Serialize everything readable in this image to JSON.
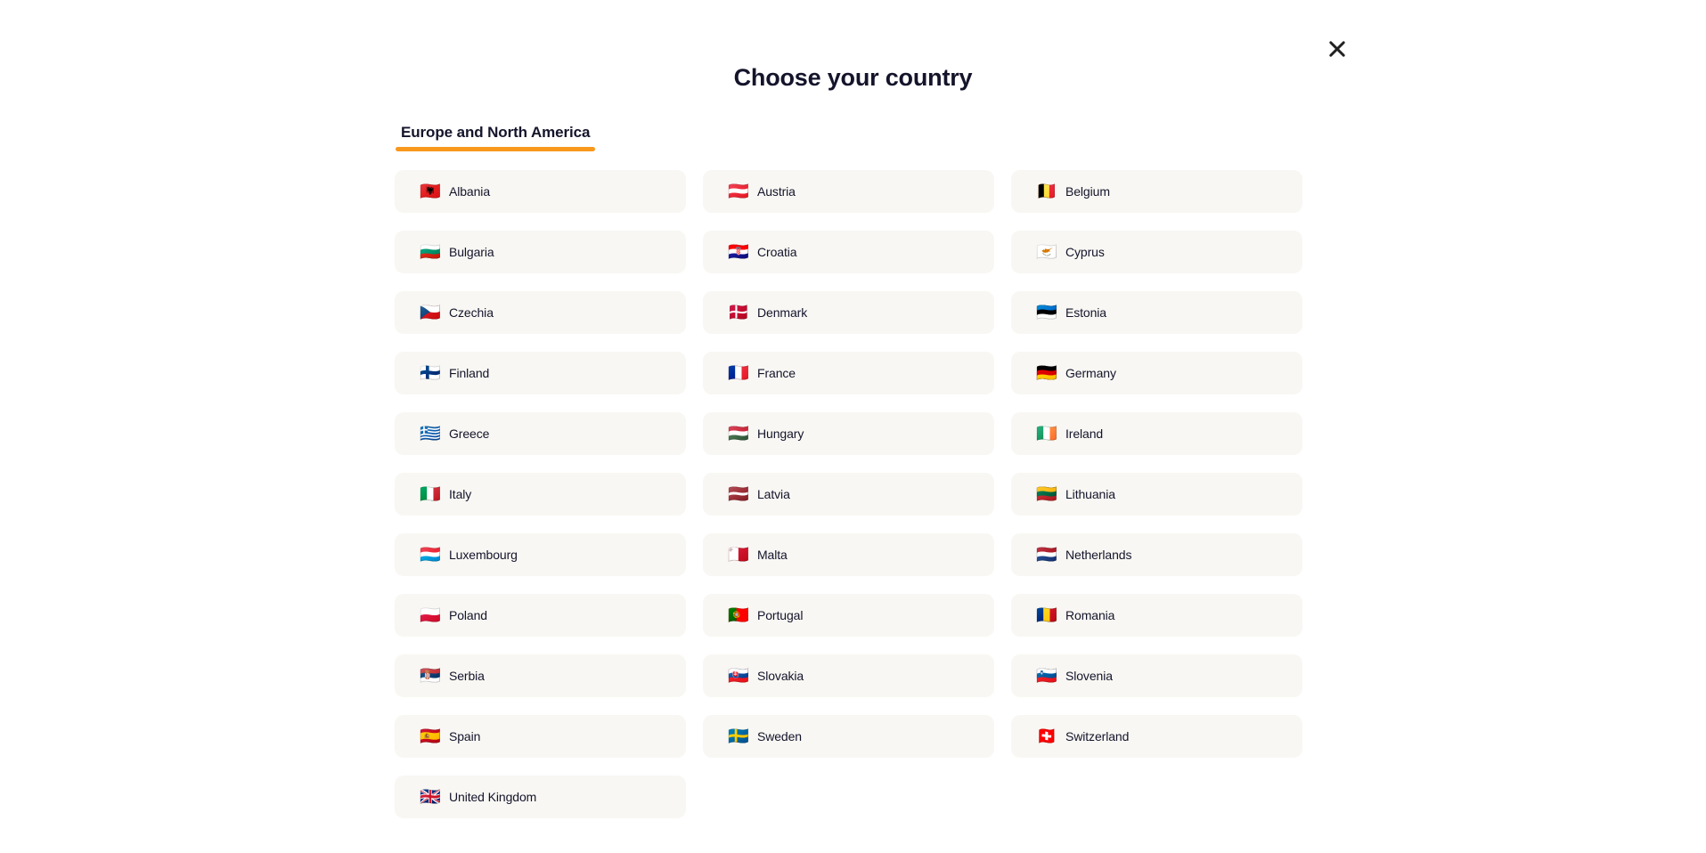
{
  "dialog": {
    "title": "Choose your country",
    "close_label": "Close",
    "close_icon": "close-icon"
  },
  "tabs": [
    {
      "id": "europe-north-america",
      "label": "Europe and North America",
      "active": true
    }
  ],
  "colors": {
    "accent": "#F8981D",
    "card_background": "#F8F7F3",
    "text": "#14142B",
    "page_background": "#FFFFFF"
  },
  "countries": [
    {
      "name": "Albania",
      "flag": "🇦🇱"
    },
    {
      "name": "Austria",
      "flag": "🇦🇹"
    },
    {
      "name": "Belgium",
      "flag": "🇧🇪"
    },
    {
      "name": "Bulgaria",
      "flag": "🇧🇬"
    },
    {
      "name": "Croatia",
      "flag": "🇭🇷"
    },
    {
      "name": "Cyprus",
      "flag": "🇨🇾"
    },
    {
      "name": "Czechia",
      "flag": "🇨🇿"
    },
    {
      "name": "Denmark",
      "flag": "🇩🇰"
    },
    {
      "name": "Estonia",
      "flag": "🇪🇪"
    },
    {
      "name": "Finland",
      "flag": "🇫🇮"
    },
    {
      "name": "France",
      "flag": "🇫🇷"
    },
    {
      "name": "Germany",
      "flag": "🇩🇪"
    },
    {
      "name": "Greece",
      "flag": "🇬🇷"
    },
    {
      "name": "Hungary",
      "flag": "🇭🇺"
    },
    {
      "name": "Ireland",
      "flag": "🇮🇪"
    },
    {
      "name": "Italy",
      "flag": "🇮🇹"
    },
    {
      "name": "Latvia",
      "flag": "🇱🇻"
    },
    {
      "name": "Lithuania",
      "flag": "🇱🇹"
    },
    {
      "name": "Luxembourg",
      "flag": "🇱🇺"
    },
    {
      "name": "Malta",
      "flag": "🇲🇹"
    },
    {
      "name": "Netherlands",
      "flag": "🇳🇱"
    },
    {
      "name": "Poland",
      "flag": "🇵🇱"
    },
    {
      "name": "Portugal",
      "flag": "🇵🇹"
    },
    {
      "name": "Romania",
      "flag": "🇷🇴"
    },
    {
      "name": "Serbia",
      "flag": "🇷🇸"
    },
    {
      "name": "Slovakia",
      "flag": "🇸🇰"
    },
    {
      "name": "Slovenia",
      "flag": "🇸🇮"
    },
    {
      "name": "Spain",
      "flag": "🇪🇸"
    },
    {
      "name": "Sweden",
      "flag": "🇸🇪"
    },
    {
      "name": "Switzerland",
      "flag": "🇨🇭"
    },
    {
      "name": "United Kingdom",
      "flag": "🇬🇧"
    }
  ]
}
